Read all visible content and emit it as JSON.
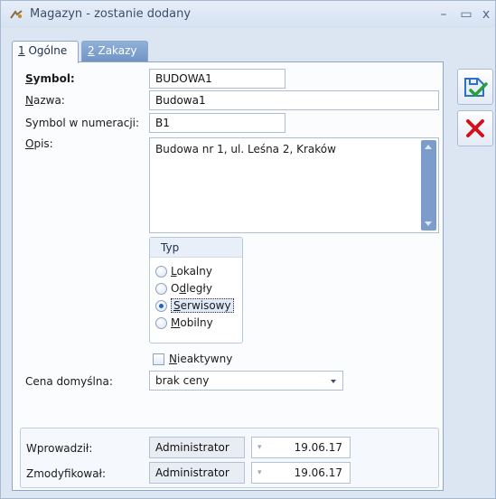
{
  "window": {
    "title": "Magazyn - zostanie dodany",
    "controls": {
      "minimize": "–",
      "maximize": "▭",
      "close": "x"
    }
  },
  "tabs": [
    {
      "number": "1",
      "label": "Ogólne",
      "active": true
    },
    {
      "number": "2",
      "label": "Zakazy",
      "active": false
    }
  ],
  "form": {
    "symbol": {
      "label_u": "S",
      "label_rest": "ymbol:",
      "value": "BUDOWA1"
    },
    "nazwa": {
      "label_u": "N",
      "label_rest": "azwa:",
      "value": "Budowa1"
    },
    "symbol_numeracja": {
      "label": "Symbol w numeracji:",
      "value": "B1"
    },
    "opis": {
      "label_u": "O",
      "label_rest": "pis:",
      "value": "Budowa nr 1, ul. Leśna 2, Kraków"
    },
    "typ": {
      "title": "Typ",
      "options": [
        {
          "u": "L",
          "rest": "okalny",
          "checked": false
        },
        {
          "u": "",
          "pre": "O",
          "u2": "d",
          "rest2": "legły",
          "checked": false
        },
        {
          "u": "S",
          "rest": "erwisowy",
          "checked": true
        },
        {
          "u": "M",
          "rest": "obilny",
          "checked": false
        }
      ]
    },
    "nieaktywny": {
      "u": "N",
      "rest": "ieaktywny",
      "checked": false
    },
    "cena_domyslna": {
      "label": "Cena domyślna:",
      "value": "brak ceny"
    }
  },
  "footer": {
    "wprowadzil": {
      "label": "Wprowadził:",
      "user": "Administrator",
      "date": "19.06.17"
    },
    "zmodyfikowal": {
      "label": "Zmodyfikował:",
      "user": "Administrator",
      "date": "19.06.17"
    }
  },
  "colors": {
    "save": "#2f6fc4",
    "cancel": "#d1121b"
  },
  "icons": {
    "save": "save-check-icon",
    "cancel": "cancel-x-icon"
  }
}
